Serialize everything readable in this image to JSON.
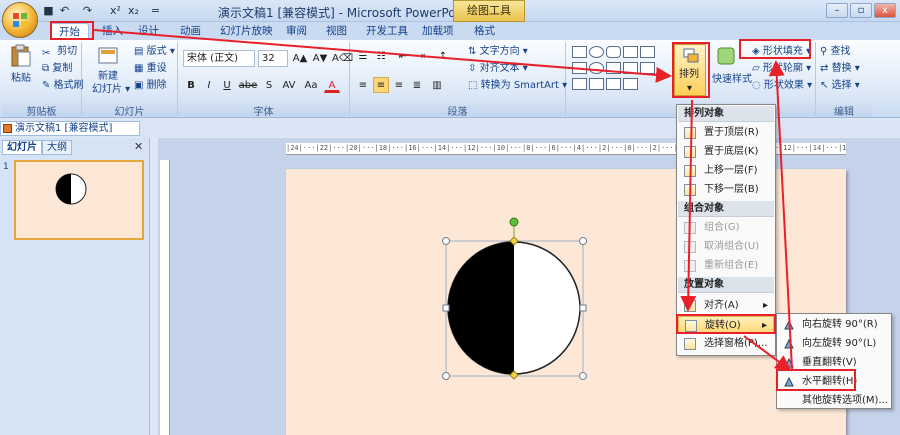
{
  "window": {
    "title": "演示文稿1 [兼容模式] - Microsoft PowerPoint",
    "context_tab": "绘图工具",
    "minimize": "–",
    "restore": "▫",
    "close": "x"
  },
  "qat": {
    "save": "■",
    "undo": "↶",
    "redo": "↷",
    "superscript": "x²",
    "subscript": "x₂",
    "more": "="
  },
  "tabs": [
    "开始",
    "插入",
    "设计",
    "动画",
    "幻灯片放映",
    "审阅",
    "视图",
    "开发工具",
    "加载项",
    "格式"
  ],
  "ribbon": {
    "clipboard": {
      "label": "剪贴板",
      "paste": "粘贴",
      "cut": "剪切",
      "copy": "复制",
      "format_painter": "格式刷"
    },
    "slides": {
      "label": "幻灯片",
      "new_slide": "新建",
      "new_slide2": "幻灯片 ▾",
      "layout": "版式 ▾",
      "reset": "重设",
      "delete": "删除"
    },
    "font": {
      "label": "字体",
      "font_name": "宋体 (正文)",
      "font_size": "32",
      "grow": "A▲",
      "shrink": "A▼",
      "clear": "A⌫",
      "bold": "B",
      "italic": "I",
      "underline": "U",
      "strike": "abe",
      "shadow": "S",
      "spacing": "AV",
      "case": "Aa",
      "color": "A"
    },
    "paragraph": {
      "label": "段落",
      "text_direction": "文字方向 ▾",
      "align_text": "对齐文本 ▾",
      "smartart": "转换为 SmartArt ▾"
    },
    "drawing": {
      "arrange": "排列",
      "quick_styles": "快速样式",
      "shape_fill": "形状填充 ▾",
      "shape_outline": "形状轮廓 ▾",
      "shape_effects": "形状效果 ▾"
    },
    "editing": {
      "label": "编辑",
      "find": "查找",
      "replace": "替换 ▾",
      "select": "选择 ▾"
    }
  },
  "document_tab": "演示文稿1 [兼容模式]",
  "pane": {
    "tab_slides": "幻灯片",
    "tab_outline": "大纲",
    "close": "✕",
    "slide_number": "1"
  },
  "ruler_text": "|24|···|22|···|20|···|18|···|16|···|14|···|12|···|10|···|8|···|6|···|4|···|2|···|0|···|2|···|4|···|6|···|8|···|10|···|12|···|14|···|16|···|18|···|20|···|22|···|24|",
  "arrange_menu": {
    "head_order": "排列对象",
    "bring_front": "置于顶层(R)",
    "send_back": "置于底层(K)",
    "forward": "上移一层(F)",
    "backward": "下移一层(B)",
    "head_group": "组合对象",
    "group": "组合(G)",
    "ungroup": "取消组合(U)",
    "regroup": "重新组合(E)",
    "head_position": "放置对象",
    "align": "对齐(A)",
    "rotate": "旋转(O)",
    "selection_pane": "选择窗格(P)..."
  },
  "rotate_menu": {
    "right90": "向右旋转 90°(R)",
    "left90": "向左旋转 90°(L)",
    "flip_v": "垂直翻转(V)",
    "flip_h": "水平翻转(H)",
    "more": "其他旋转选项(M)..."
  },
  "colors": {
    "highlight": "#e8202a",
    "menu_hot": "#ffd775",
    "slide_bg": "#fde8d7",
    "ribbon": "#dce8f7"
  }
}
